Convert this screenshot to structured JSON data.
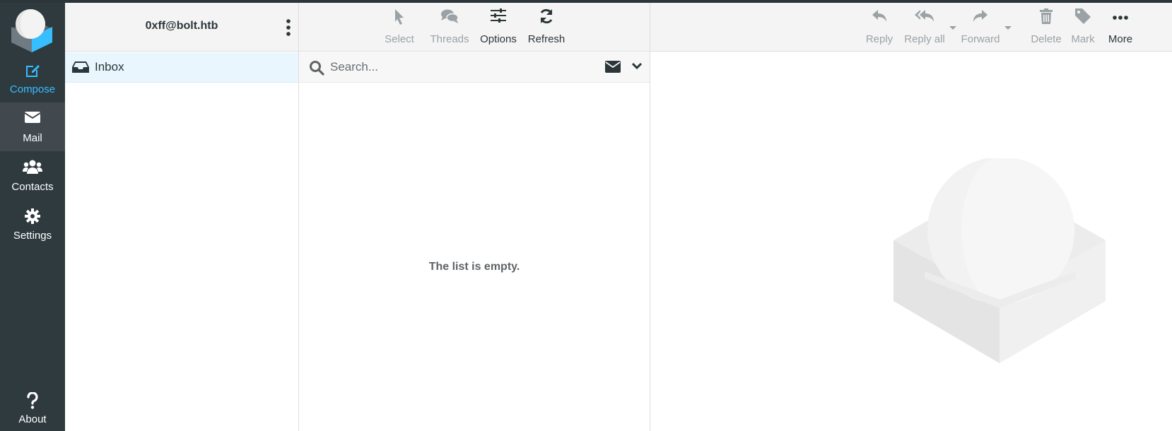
{
  "account": {
    "email": "0xff@bolt.htb"
  },
  "nav": {
    "items": [
      {
        "label": "Compose",
        "icon": "compose-icon"
      },
      {
        "label": "Mail",
        "icon": "envelope-icon"
      },
      {
        "label": "Contacts",
        "icon": "users-icon"
      },
      {
        "label": "Settings",
        "icon": "gear-icon"
      }
    ],
    "about": {
      "label": "About",
      "icon": "question-icon"
    }
  },
  "folders": [
    {
      "label": "Inbox",
      "icon": "inbox-icon",
      "selected": true
    }
  ],
  "list_toolbar": [
    {
      "label": "Select",
      "icon": "cursor-icon",
      "enabled": false
    },
    {
      "label": "Threads",
      "icon": "threads-icon",
      "enabled": false
    },
    {
      "label": "Options",
      "icon": "sliders-icon",
      "enabled": true
    },
    {
      "label": "Refresh",
      "icon": "refresh-icon",
      "enabled": true
    }
  ],
  "search": {
    "placeholder": "Search...",
    "value": ""
  },
  "message_list": {
    "empty_text": "The list is empty."
  },
  "preview_toolbar": [
    {
      "label": "Reply",
      "icon": "reply-icon",
      "enabled": false
    },
    {
      "label": "Reply all",
      "icon": "reply-all-icon",
      "enabled": false
    },
    {
      "label": "Forward",
      "icon": "forward-icon",
      "enabled": false
    },
    {
      "label": "Delete",
      "icon": "trash-icon",
      "enabled": false
    },
    {
      "label": "Mark",
      "icon": "tag-icon",
      "enabled": false
    },
    {
      "label": "More",
      "icon": "more-icon",
      "enabled": true
    }
  ],
  "colors": {
    "nav_bg": "#2f3a3f",
    "accent": "#37beff",
    "selected_folder_bg": "#e9f6fd",
    "disabled_text": "#9aa2a6"
  }
}
